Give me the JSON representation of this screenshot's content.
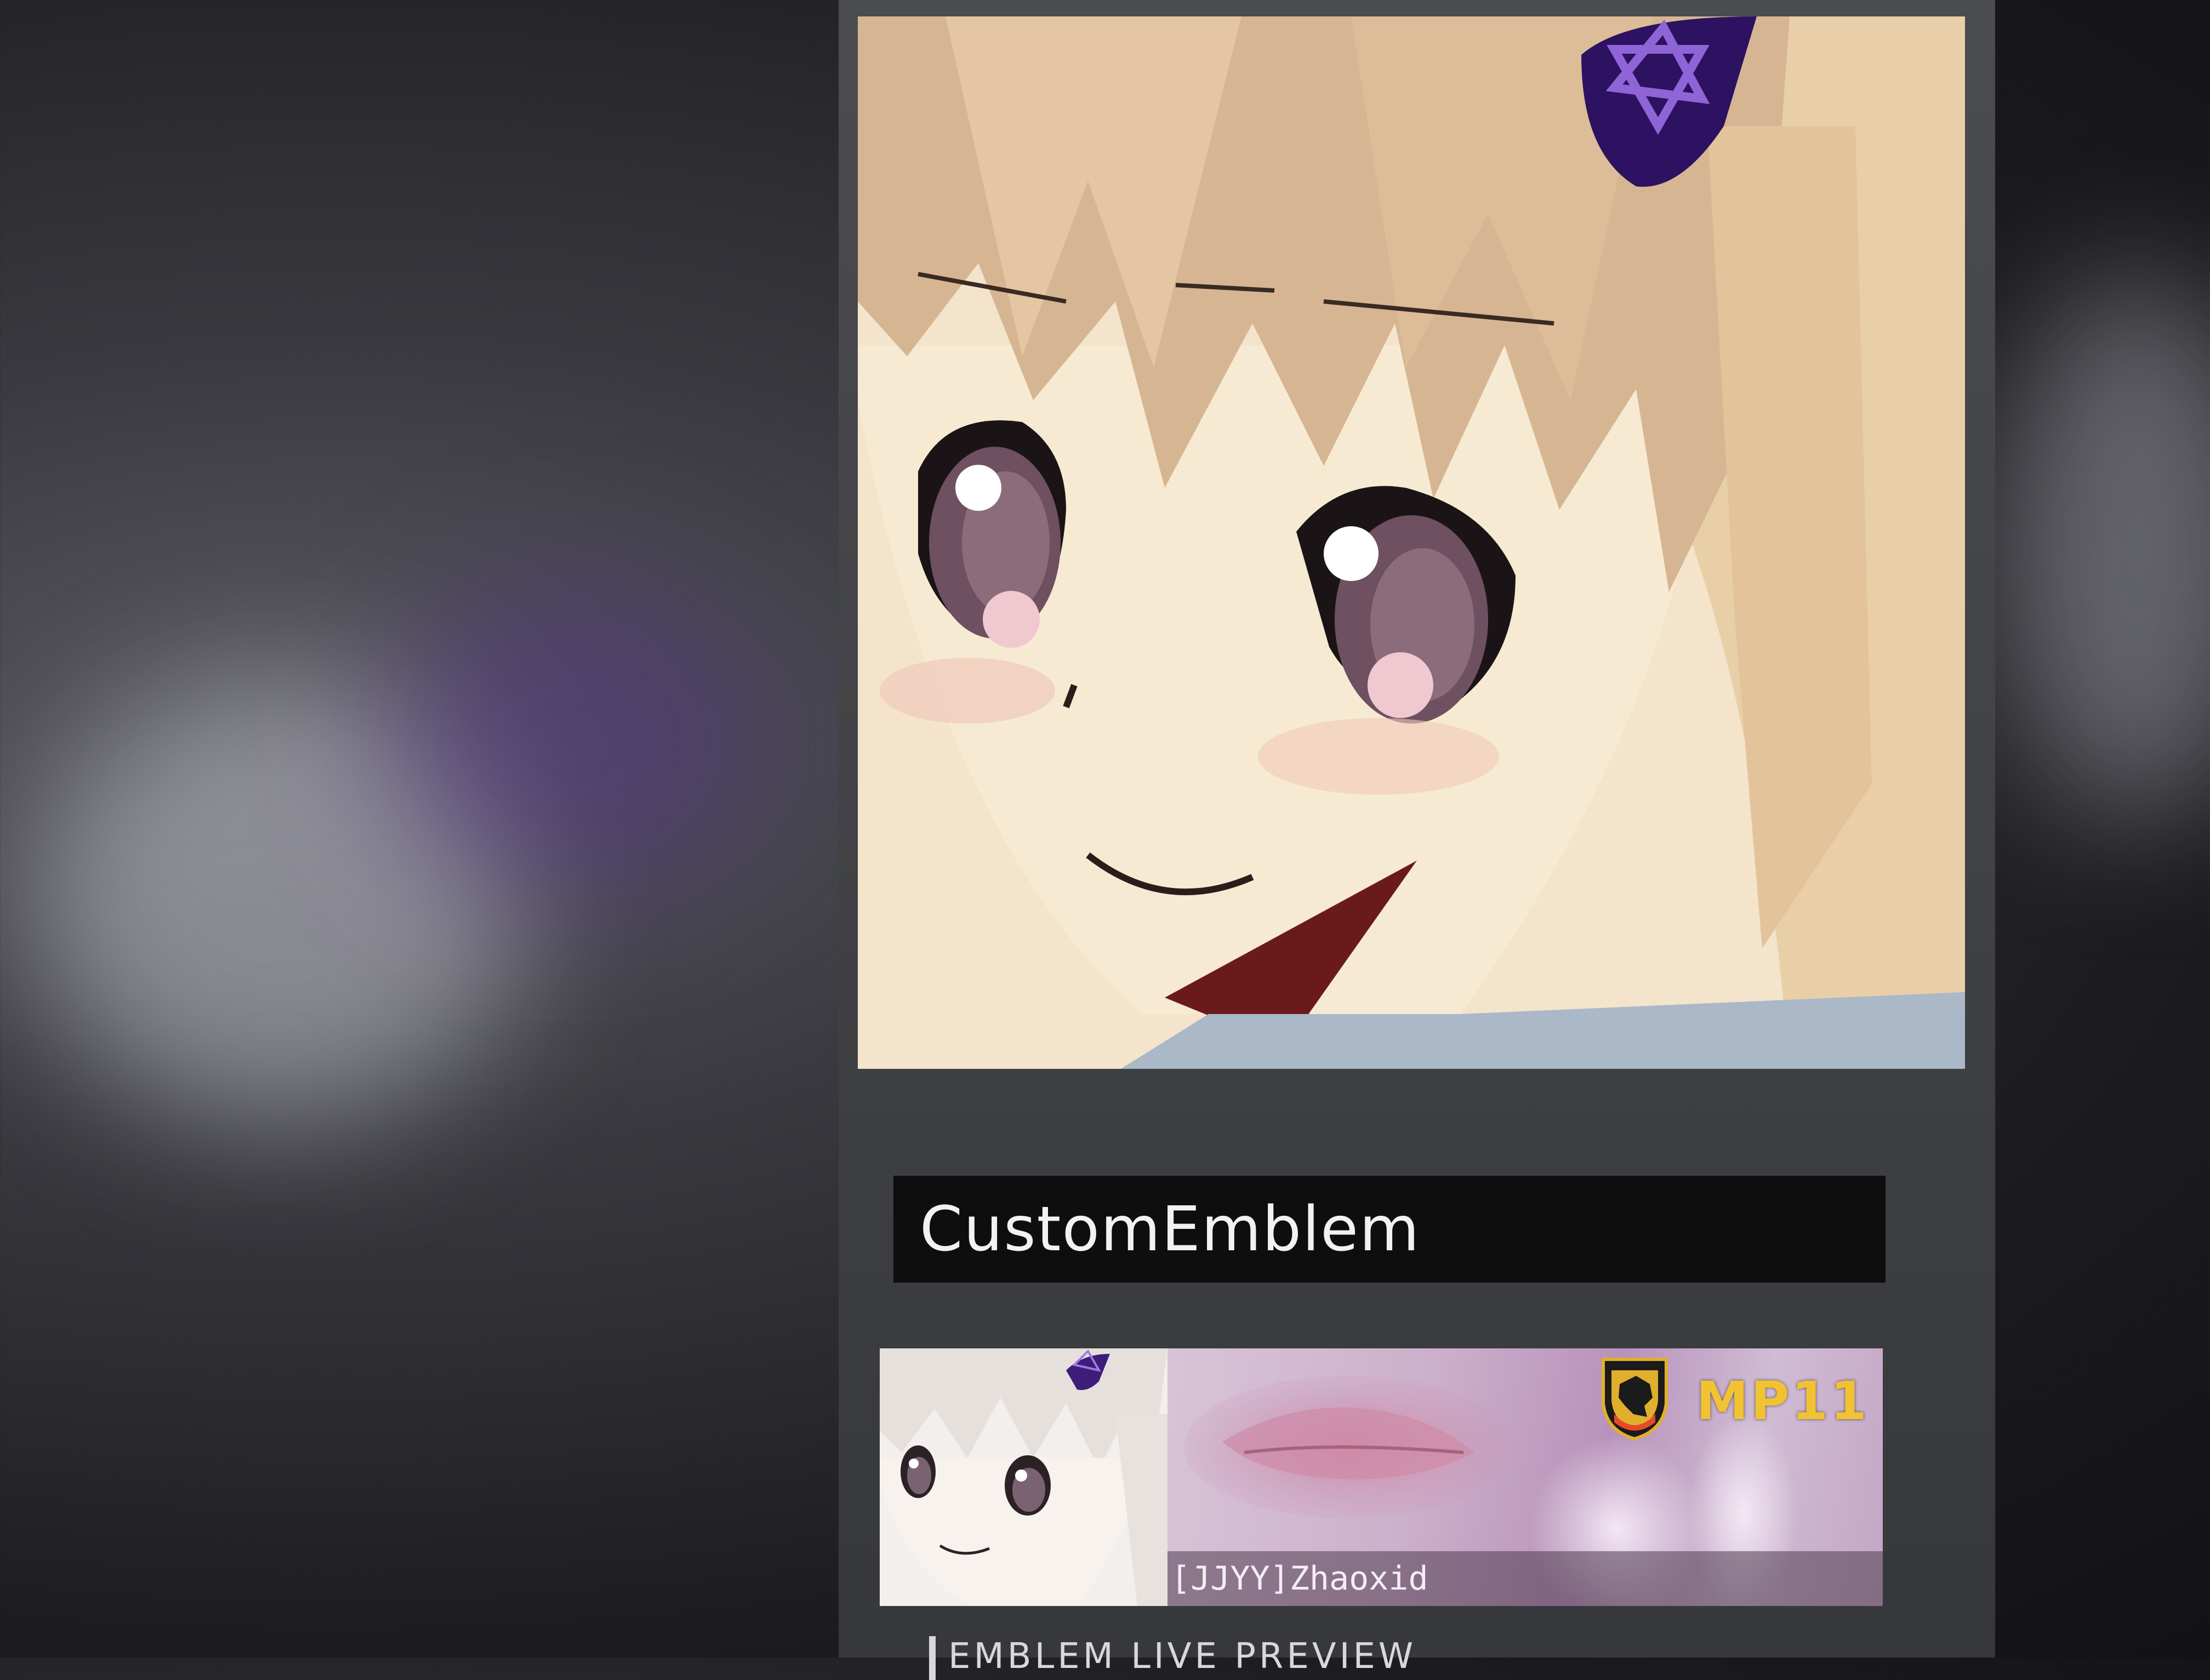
{
  "emblem": {
    "name_field_value": "CustomEmblem",
    "large_preview_icon": "anime-girl-emblem-icon"
  },
  "calling_card": {
    "player_name": "[JJYY]Zhaoxid",
    "weapon": "MP11",
    "rank_icon": "wolf-shield-icon"
  },
  "section": {
    "live_preview_label": "EMBLEM LIVE PREVIEW"
  },
  "colors": {
    "weapon_accent": "#f1c232",
    "name_field_bg": "#0e0e0f",
    "hair_clip": "#3a1a6e"
  }
}
